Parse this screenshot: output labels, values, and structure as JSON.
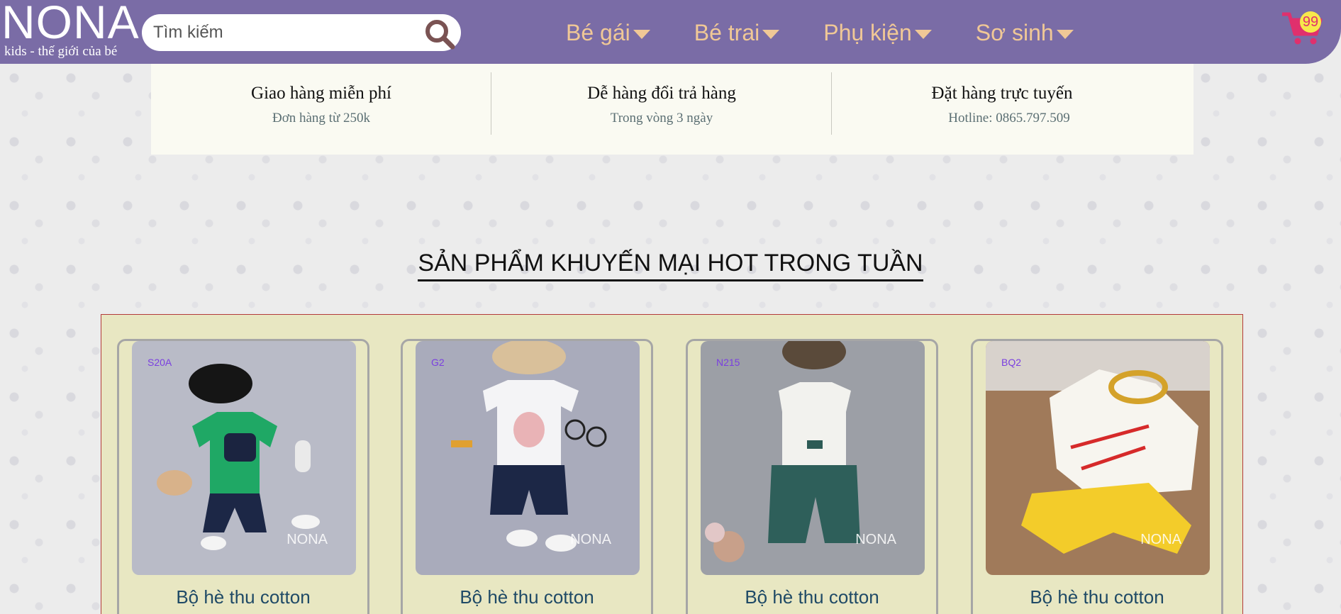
{
  "header": {
    "logo": {
      "name": "NONA",
      "tagline": "kids - thế giới của bé"
    },
    "search": {
      "placeholder": "Tìm kiếm",
      "value": ""
    },
    "nav": [
      {
        "label": "Bé gái"
      },
      {
        "label": "Bé trai"
      },
      {
        "label": "Phụ kiện"
      },
      {
        "label": "Sơ sinh"
      }
    ],
    "cart_count": "99"
  },
  "info": [
    {
      "title": "Giao hàng miễn phí",
      "sub": "Đơn hàng từ 250k"
    },
    {
      "title": "Dễ hàng đổi trả hàng",
      "sub": "Trong vòng 3 ngày"
    },
    {
      "title": "Đặt hàng trực tuyến",
      "sub": "Hotline: 0865.797.509"
    }
  ],
  "section_title": "SẢN PHẨM KHUYẾN MẠI HOT TRONG TUẦN",
  "products": [
    {
      "code": "S20A",
      "name": "Bộ hè thu cotton",
      "watermark": "NONA",
      "photo_color": "#b9bbc7"
    },
    {
      "code": "G2",
      "name": "Bộ hè thu cotton",
      "watermark": "NONA",
      "photo_color": "#a9abbb"
    },
    {
      "code": "N215",
      "name": "Bộ hè thu cotton",
      "watermark": "NONA",
      "photo_color": "#9c9fa6"
    },
    {
      "code": "BQ2",
      "name": "Bộ hè thu cotton",
      "watermark": "NONA",
      "photo_color": "#a07a5a"
    }
  ],
  "colors": {
    "header_bg": "#7a6ca6",
    "nav_text": "#f0c896",
    "products_bg": "#e8e7c2",
    "cart": "#e0306d"
  }
}
